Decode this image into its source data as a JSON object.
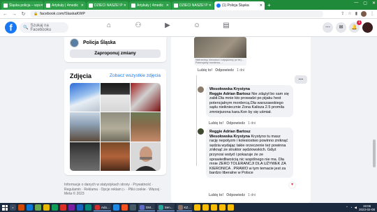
{
  "browser": {
    "tabs": [
      {
        "label": "Śląska policja – wys",
        "active": false
      },
      {
        "label": "Artykuły | 4medic",
        "active": false
      },
      {
        "label": "DZIECI NASZE! P",
        "active": false
      },
      {
        "label": "Artykuły | 4medic",
        "active": false
      },
      {
        "label": "DZIECI NASZE! P",
        "active": false
      },
      {
        "label": "(1) Policja Śląska",
        "active": true
      }
    ],
    "url": "facebook.com/SlaskaKWP"
  },
  "fb": {
    "logo": "f",
    "search_placeholder": "Szukaj na Facebooku",
    "notification_count": "1"
  },
  "page": {
    "name": "Policja Śląska",
    "change_button": "Zaproponuj zmiany"
  },
  "photos": {
    "title": "Zdjęcia",
    "see_all": "Zobacz wszystkie zdjęcia"
  },
  "footer": {
    "text": "Informacje o danych w statystykach strony · Prywatność · Regulamin · Reklama · Opcje reklam ▷ · Pliki cookie · Więcej · Meta © 2023"
  },
  "post_preview": {
    "caption": "Nietrzeźwy, kierowca i rozpędzony (w tle)... Potencjalny morderca, ..."
  },
  "comment_actions": {
    "like": "Lubię to!",
    "reply": "Odpowiedz",
    "time": "1 dni"
  },
  "comments": [
    {
      "author": "Wesołowska Krystyna",
      "mention": "Reggie Adrian Bartosz",
      "text": " Nie zdążył bo sam się zabił.Dla mnie kto prowadzi po pijaku hest potencjalnym mordercą.Dla warszawskiego sądu nieikniecznie Zona Kalisza 2.5 promila zmniejszona kara.Kon by się uśmiał."
    },
    {
      "author": "Reggie Adrian Bartosz",
      "mention": "Wesołowska Krystyna",
      "text": " Krystyno tu masz rację nepotyzm i kolesiostwo powinno zniknąć sędzia wydając takie orzeczenie też powinna zniknąć ze struktor sędziowskich. Gdyż przynosi wstyd i pokazuje że ze sprawiedliwością nic wspólnego nie ma. Dla mnie ZERO TOLERANCJI DLA UŻYWEK ZA KIERONICA . PRAWO w tym temacie jest za bardzo liberalne w Polsce"
    }
  ],
  "taskbar": {
    "apps": [
      "Ado...",
      "GM...",
      "Sen...",
      "KZ..."
    ],
    "time": "19:06",
    "date": "2023-02-08"
  },
  "colors": {
    "fb_blue": "#1877f2",
    "tab_green": "#1e8a3a",
    "taskbar": "#1c2a3f"
  }
}
